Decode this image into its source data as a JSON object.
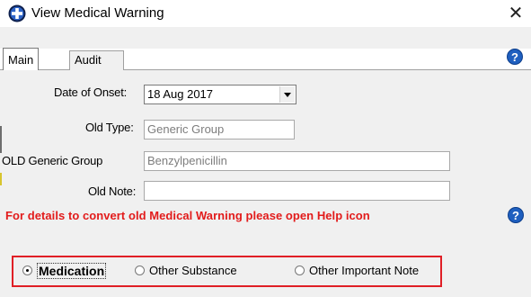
{
  "window": {
    "title": "View Medical Warning",
    "close_glyph": "✕"
  },
  "tabs": [
    {
      "label": "Main"
    },
    {
      "label": "Audit"
    }
  ],
  "help_glyph": "?",
  "form": {
    "date_of_onset": {
      "label": "Date of Onset:",
      "value": "18 Aug 2017"
    },
    "old_type": {
      "label": "Old Type:",
      "value": "Generic Group"
    },
    "old_generic_group": {
      "label": "OLD Generic Group",
      "value": "Benzylpenicillin"
    },
    "old_note": {
      "label": "Old Note:",
      "value": ""
    }
  },
  "message": "For details to convert old Medical Warning please open Help icon",
  "radios": [
    {
      "label": "Medication",
      "checked": true
    },
    {
      "label": "Other Substance",
      "checked": false
    },
    {
      "label": "Other Important Note",
      "checked": false
    }
  ],
  "colors": {
    "message": "#e21b1b",
    "highlight_box": "#e01f26",
    "help_icon": "#1f5fbf"
  }
}
